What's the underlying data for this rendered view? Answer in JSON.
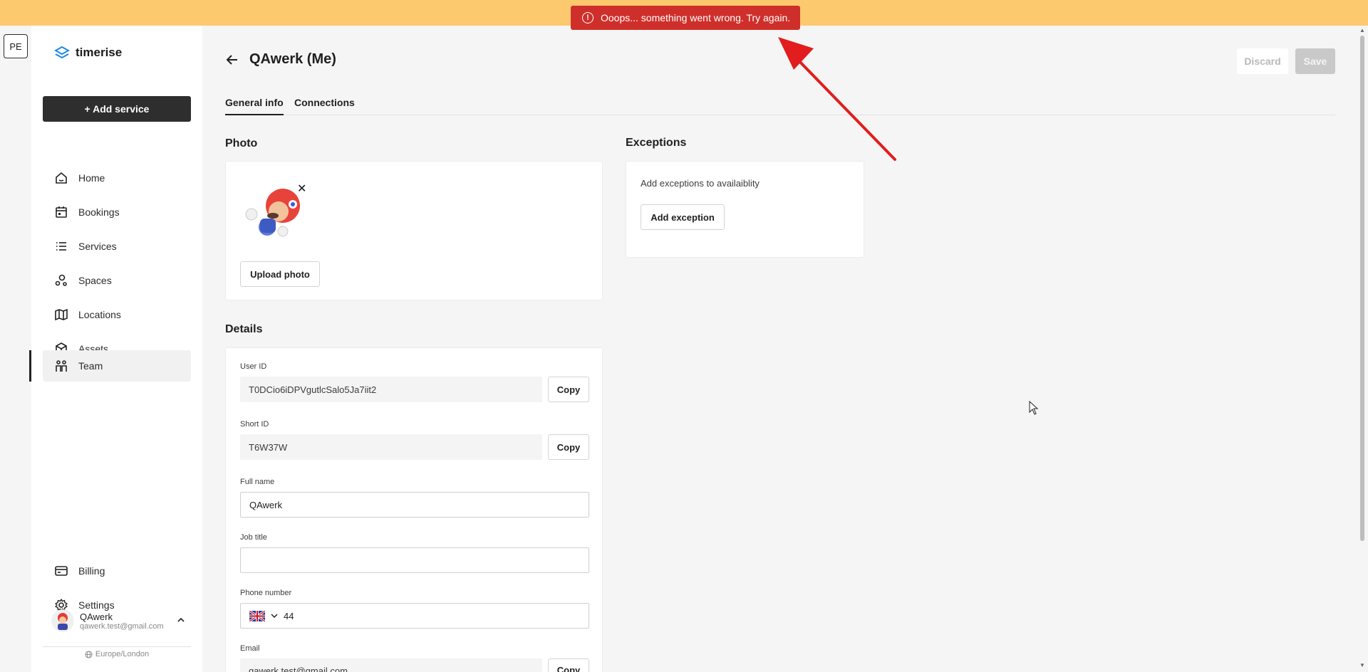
{
  "toast": {
    "message": "Ooops... something went wrong. Try again.",
    "icon": "alert-circle-icon",
    "color": "#cf2f2a"
  },
  "banner": {
    "color": "#fdc96e"
  },
  "workspace": {
    "initials": "PE"
  },
  "sidebar": {
    "brand": "timerise",
    "add_service": "+ Add service",
    "items": [
      {
        "label": "Home",
        "icon": "home-icon"
      },
      {
        "label": "Bookings",
        "icon": "calendar-icon"
      },
      {
        "label": "Services",
        "icon": "list-icon"
      },
      {
        "label": "Spaces",
        "icon": "spaces-icon"
      },
      {
        "label": "Locations",
        "icon": "map-icon"
      },
      {
        "label": "Assets",
        "icon": "box-icon"
      },
      {
        "label": "Team",
        "icon": "team-icon",
        "active": true
      }
    ],
    "bottom_items": [
      {
        "label": "Billing",
        "icon": "credit-card-icon"
      },
      {
        "label": "Settings",
        "icon": "gear-icon"
      }
    ],
    "user": {
      "name": "QAwerk",
      "email": "qawerk.test@gmail.com"
    },
    "timezone": "Europe/London"
  },
  "header": {
    "title": "QAwerk (Me)",
    "discard": "Discard",
    "save": "Save"
  },
  "tabs": [
    {
      "label": "General info",
      "active": true
    },
    {
      "label": "Connections",
      "active": false
    }
  ],
  "photo": {
    "title": "Photo",
    "upload": "Upload photo"
  },
  "exceptions": {
    "title": "Exceptions",
    "text": "Add exceptions to availaiblity",
    "button": "Add exception"
  },
  "details": {
    "title": "Details",
    "user_id": {
      "label": "User ID",
      "value": "T0DCio6iDPVgutlcSalo5Ja7iit2",
      "copy": "Copy"
    },
    "short_id": {
      "label": "Short ID",
      "value": "T6W37W",
      "copy": "Copy"
    },
    "full_name": {
      "label": "Full name",
      "value": "QAwerk"
    },
    "job_title": {
      "label": "Job title",
      "value": ""
    },
    "phone": {
      "label": "Phone number",
      "value": "44"
    },
    "email": {
      "label": "Email",
      "value": "qawerk.test@gmail.com",
      "copy": "Copy"
    }
  }
}
